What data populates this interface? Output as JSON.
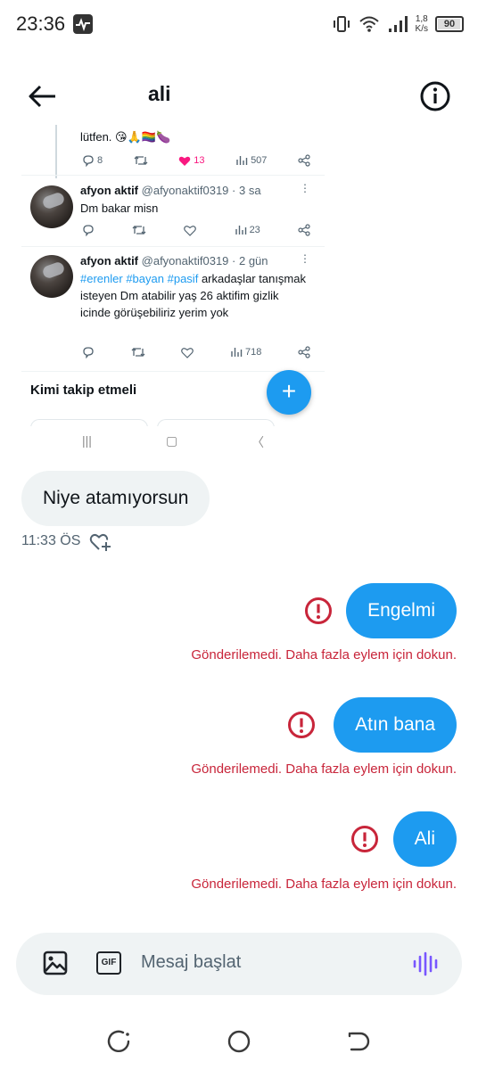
{
  "status_bar": {
    "time": "23:36",
    "net_speed_value": "1,8",
    "net_speed_unit": "K/s",
    "battery": "90"
  },
  "header": {
    "title": "ali"
  },
  "embedded_screenshot": {
    "top_tweet_text": "lütfen. 😘🙏🏳️‍🌈🍆",
    "top_tweet_actions": {
      "replies": "8",
      "likes": "13",
      "views": "507"
    },
    "tweets": [
      {
        "name": "afyon aktif",
        "handle": "@afyonaktif0319",
        "time": "· 3 sa",
        "text": "Dm bakar misn",
        "views": "23"
      },
      {
        "name": "afyon aktif",
        "handle": "@afyonaktif0319",
        "time": "· 2 gün",
        "hashtags": [
          "#erenler",
          "#bayan",
          "#pasif"
        ],
        "text": "arkadaşlar tanışmak isteyen Dm atabilir yaş 26 aktifim gizlik icinde görüşebiliriz yerim yok",
        "views": "718"
      }
    ],
    "who_to_follow": "Kimi takip etmeli",
    "fab_label": "+"
  },
  "chat": {
    "incoming": {
      "text": "Niye atamıyorsun",
      "time": "11:33 ÖS"
    },
    "outgoing": [
      {
        "text": "Engelmi",
        "error": "Gönderilemedi. Daha fazla eylem için dokun."
      },
      {
        "text": "Atın bana",
        "error": "Gönderilemedi. Daha fazla eylem için dokun."
      },
      {
        "text": "Ali",
        "error": "Gönderilemedi. Daha fazla eylem için dokun."
      }
    ]
  },
  "composer": {
    "gif_label": "GIF",
    "placeholder": "Mesaj başlat"
  },
  "colors": {
    "accent": "#1d9bf0",
    "error": "#c8253a",
    "like": "#f91880",
    "bubble_incoming": "#eff3f4"
  }
}
